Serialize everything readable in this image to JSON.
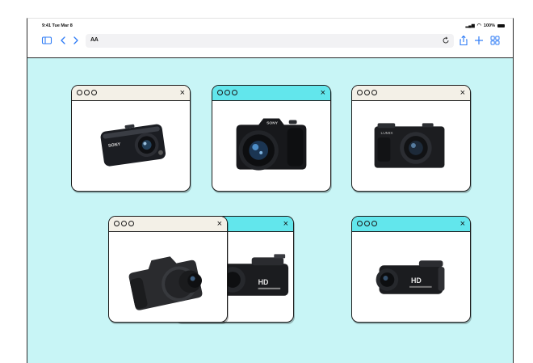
{
  "status_bar": {
    "time_date": "9:41  Tue Mar 8",
    "battery": "100%"
  },
  "toolbar": {
    "address_aa": "AA"
  },
  "windows": [
    {
      "id": "win-1",
      "bar_style": "cream",
      "close_label": "×",
      "camera": "compact-sony-camera"
    },
    {
      "id": "win-2",
      "bar_style": "cyan",
      "close_label": "×",
      "camera": "bridge-sony-camera"
    },
    {
      "id": "win-3",
      "bar_style": "cream",
      "close_label": "×",
      "camera": "lumix-compact-camera"
    },
    {
      "id": "win-4",
      "bar_style": "cyan",
      "close_label": "×",
      "camera": "hd-camcorder-partial"
    },
    {
      "id": "win-5",
      "bar_style": "cream",
      "close_label": "×",
      "camera": "dslr-camera"
    },
    {
      "id": "win-6",
      "bar_style": "cyan",
      "close_label": "×",
      "camera": "hd-camcorder"
    }
  ],
  "camera_labels": {
    "sony": "SONY",
    "lumix": "LUMIX",
    "hd": "HD"
  },
  "colors": {
    "content_bg": "#c8f5f6",
    "bar_cyan": "#62e6ec",
    "bar_cream": "#f3f0e7",
    "toolbar_accent": "#2f7cf6"
  }
}
